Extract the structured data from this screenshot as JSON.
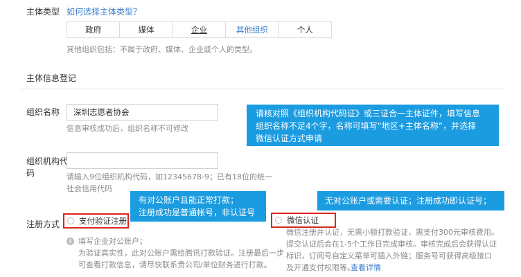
{
  "entity_type": {
    "label": "主体类型",
    "help_link": "如何选择主体类型？",
    "tabs": [
      {
        "label": "政府"
      },
      {
        "label": "媒体"
      },
      {
        "label": "企业"
      },
      {
        "label": "其他组织"
      },
      {
        "label": "个人"
      }
    ],
    "note": "其他组织包括：不属于政府、媒体、企业或个人的类型。"
  },
  "section_title": "主体信息登记",
  "org_name": {
    "label": "组织名称",
    "value": "深圳志愿者协会",
    "hint": "信息审核成功后，组织名称不可修改"
  },
  "org_code": {
    "label_line1": "组织机构代",
    "label_line2": "码",
    "value": "",
    "hint_line1": "请输入9位组织机构代码，如12345678-9；已有18位的统一",
    "hint_line2": "社会信用代码"
  },
  "callouts": {
    "top_line1": "请核对照《组织机构代码证》或三证合一主体证件，填写信息",
    "top_line2": "组织名称不足4个字，名称可填写“地区+主体名称”，并选择",
    "top_line3": "微信认证方式申请",
    "left_line1": "有对公账户且能正常打款；",
    "left_line2": "注册成功是普通帐号，非认证号",
    "right": "无对公账户或需要认证；注册成功即认证号；"
  },
  "registration": {
    "label": "注册方式",
    "option_pay": "支付验证注册",
    "option_wechat": "微信认证",
    "pay_line1": "填写企业对公账户；",
    "pay_line2": "为验证真实性，此对公账户需给腾讯打款验证。注册最后一步",
    "pay_line3": "可查看打款信息，请尽快联系贵公司/单位财务进行打款。",
    "wechat_line1": "微信注册并认证，无需小额打款验证，需支付300元审核费用。",
    "wechat_line2": "提交认证后会在1-5个工作日完成审核。审核完成后会获得认证",
    "wechat_line3": "标识，订阅号自定义菜单可插入外链；服务号可获得高级接口",
    "wechat_line4": "及开通支付权限等。",
    "wechat_more": "查看详情"
  },
  "colors": {
    "accent": "#3b7fcf",
    "callout": "#1b9be0",
    "highlight": "#d9261c"
  }
}
